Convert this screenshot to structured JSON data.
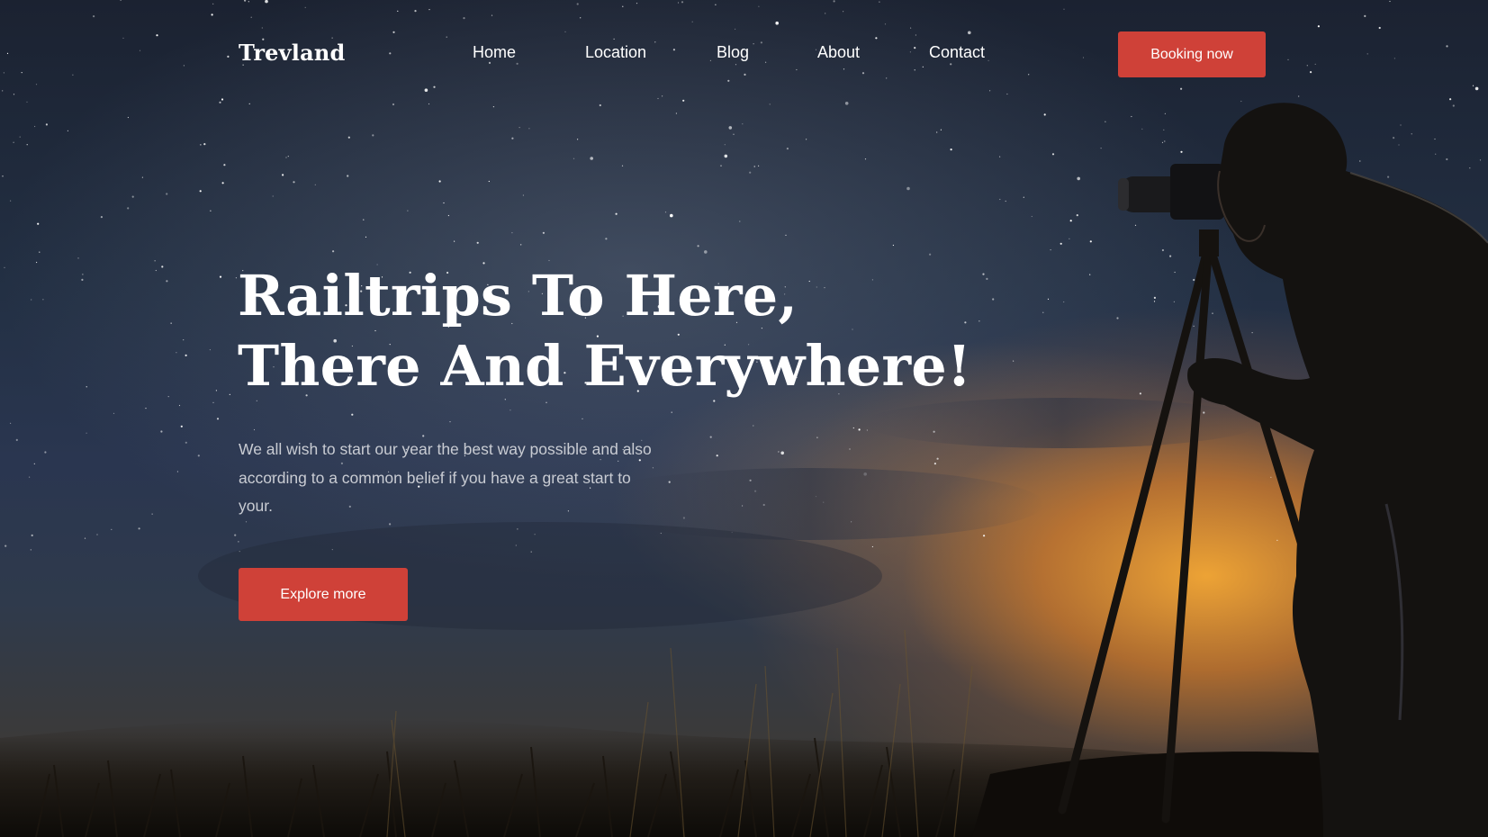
{
  "brand": {
    "logo_text": "Trevland"
  },
  "nav": {
    "items": [
      {
        "label": "Home"
      },
      {
        "label": "Location"
      },
      {
        "label": "Blog"
      },
      {
        "label": "About"
      },
      {
        "label": "Contact"
      }
    ],
    "booking_label": "Booking now"
  },
  "hero": {
    "title_line_1": "Railtrips To Here,",
    "title_line_2": "There And Everywhere!",
    "description": "We all wish to start our year the best way possible and also according to a common belief if you have a great start to your.",
    "cta_label": "Explore more"
  },
  "colors": {
    "accent": "#cf4138",
    "text_primary": "#ffffff",
    "text_secondary": "#c9ccd3"
  },
  "background": {
    "icon": "night-sky-photographer-image"
  }
}
